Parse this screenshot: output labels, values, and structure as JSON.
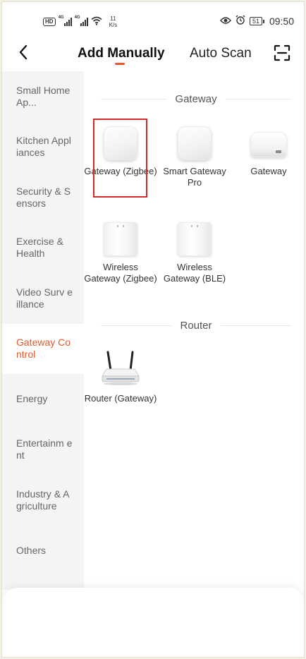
{
  "status_bar": {
    "hd": "HD",
    "net1": "4G",
    "net2": "4G",
    "speed_value": "11",
    "speed_unit": "K/s",
    "battery": "51",
    "time": "09:50"
  },
  "header": {
    "tab_manual": "Add Manually",
    "tab_scan": "Auto Scan",
    "back_icon": "chevron-left-icon",
    "scan_icon": "scan-frame-icon",
    "accent": "#e8572a"
  },
  "sidebar": {
    "items": [
      {
        "label": "Small Home Ap...",
        "active": false
      },
      {
        "label": "Kitchen Appliances",
        "active": false
      },
      {
        "label": "Security & Sensors",
        "active": false
      },
      {
        "label": "Exercise & Health",
        "active": false
      },
      {
        "label": "Video Surv eillance",
        "active": false
      },
      {
        "label": "Gateway Control",
        "active": true
      },
      {
        "label": "Energy",
        "active": false
      },
      {
        "label": "Entertainm ent",
        "active": false
      },
      {
        "label": "Industry & Agriculture",
        "active": false
      },
      {
        "label": "Others",
        "active": false
      }
    ]
  },
  "sections": [
    {
      "title": "Gateway",
      "devices": [
        {
          "label": "Gateway (Zigbee)",
          "icon": "square-hub-icon",
          "selected": true
        },
        {
          "label": "Smart Gateway Pro",
          "icon": "square-hub-icon"
        },
        {
          "label": "Gateway",
          "icon": "flat-hub-icon"
        },
        {
          "label": "Wireless Gateway (Zigbee)",
          "icon": "plug-hub-icon"
        },
        {
          "label": "Wireless Gateway (BLE)",
          "icon": "plug-hub-icon"
        }
      ]
    },
    {
      "title": "Router",
      "devices": [
        {
          "label": "Router (Gateway)",
          "icon": "router-icon"
        }
      ]
    }
  ],
  "colors": {
    "selection_box": "#d32a2a",
    "sidebar_bg": "#f4f4f4"
  }
}
